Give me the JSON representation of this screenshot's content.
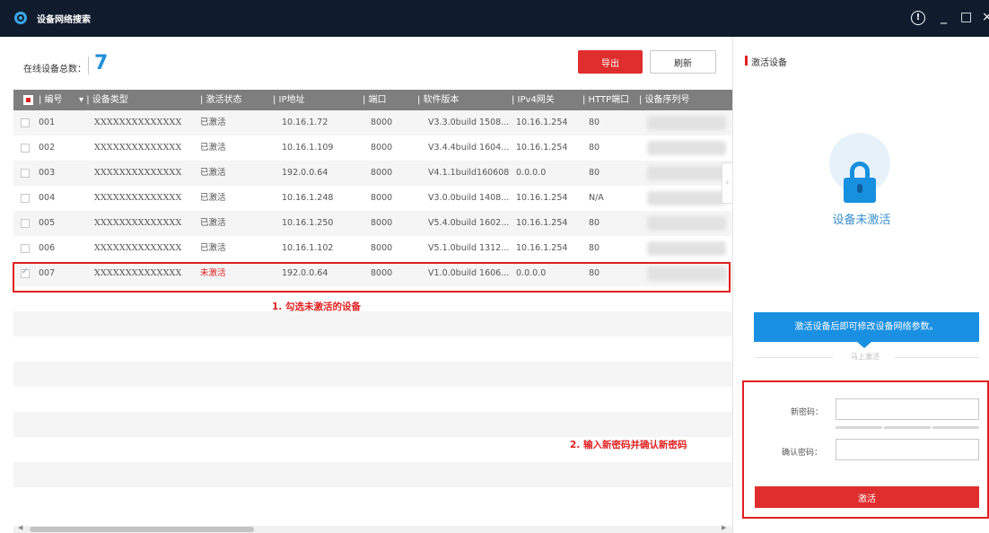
{
  "window": {
    "title": "设备网络搜索",
    "info_glyph": "!",
    "minimize_glyph": "_",
    "maximize_glyph": "□",
    "close_glyph": "×"
  },
  "summary": {
    "online_label": "在线设备总数：",
    "online_count": "7"
  },
  "toolbar": {
    "export_label": "导出",
    "refresh_label": "刷新"
  },
  "table": {
    "columns": [
      "| 编号",
      "▾ | 设备类型",
      "| 激活状态",
      "| IP地址",
      "| 端口",
      "| 软件版本",
      "| IPv4网关",
      "| HTTP端口",
      "| 设备序列号"
    ],
    "rows": [
      {
        "id": "001",
        "type": "XXXXXXXXXXXXXX",
        "status": "已激活",
        "ip": "10.16.1.72",
        "port": "8000",
        "version": "V3.3.0build 1508...",
        "gateway": "10.16.1.254",
        "http": "80",
        "checked": false
      },
      {
        "id": "002",
        "type": "XXXXXXXXXXXXXX",
        "status": "已激活",
        "ip": "10.16.1.109",
        "port": "8000",
        "version": "V3.4.4build 1604...",
        "gateway": "10.16.1.254",
        "http": "80",
        "checked": false
      },
      {
        "id": "003",
        "type": "XXXXXXXXXXXXXX",
        "status": "已激活",
        "ip": "192.0.0.64",
        "port": "8000",
        "version": "V4.1.1build160608",
        "gateway": "0.0.0.0",
        "http": "80",
        "checked": false
      },
      {
        "id": "004",
        "type": "XXXXXXXXXXXXXX",
        "status": "已激活",
        "ip": "10.16.1.248",
        "port": "8000",
        "version": "V3.0.0build 1408...",
        "gateway": "10.16.1.254",
        "http": "N/A",
        "checked": false
      },
      {
        "id": "005",
        "type": "XXXXXXXXXXXXXX",
        "status": "已激活",
        "ip": "10.16.1.250",
        "port": "8000",
        "version": "V5.4.0build 1602...",
        "gateway": "10.16.1.254",
        "http": "80",
        "checked": false
      },
      {
        "id": "006",
        "type": "XXXXXXXXXXXXXX",
        "status": "已激活",
        "ip": "10.16.1.102",
        "port": "8000",
        "version": "V5.1.0build 1312...",
        "gateway": "10.16.1.254",
        "http": "80",
        "checked": false
      },
      {
        "id": "007",
        "type": "XXXXXXXXXXXXXX",
        "status": "未激活",
        "ip": "192.0.0.64",
        "port": "8000",
        "version": "V1.0.0build 1606...",
        "gateway": "0.0.0.0",
        "http": "80",
        "checked": true
      }
    ],
    "empty_row_count": 8
  },
  "annotations": {
    "step1": "1. 勾选未激活的设备",
    "step2": "2. 输入新密码并确认新密码"
  },
  "panel": {
    "title": "激活设备",
    "status_text": "设备未激活",
    "tip": "激活设备后即可修改设备网络参数。",
    "activate_now": "马上激活",
    "new_password_label": "新密码：",
    "confirm_password_label": "确认密码：",
    "new_password_value": "",
    "confirm_password_value": "",
    "activate_label": "激活"
  },
  "colors": {
    "accent_red": "#e02d2d",
    "accent_blue": "#1a90e2",
    "titlebar": "#101c2e"
  }
}
